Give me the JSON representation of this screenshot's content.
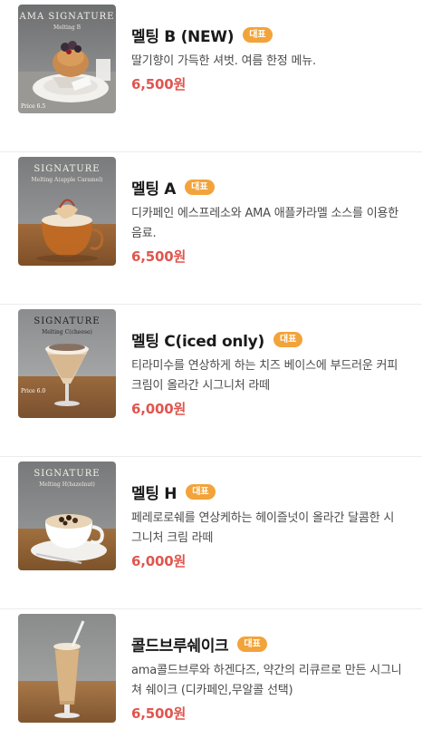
{
  "badge_color": "#f2a33a",
  "price_color": "#e0564f",
  "items": [
    {
      "name": "멜팅 B (NEW)",
      "badge": "대표",
      "description": "딸기향이 가득한 셔벗. 여름 한정 메뉴.",
      "price": "6,500원",
      "photo": {
        "sign_title": "AMA SIGNATURE",
        "sign_subtitle": "Melting B",
        "price_mark": "Price 6.5"
      }
    },
    {
      "name": "멜팅 A",
      "badge": "대표",
      "description": "디카페인 에스프레소와 AMA 애플카라멜 소스를 이용한 음료.",
      "price": "6,500원",
      "photo": {
        "sign_title": "SIGNATURE",
        "sign_subtitle": "Melting A(apple Caramel)",
        "price_mark": ""
      }
    },
    {
      "name": "멜팅 C(iced only)",
      "badge": "대표",
      "description": "티라미수를 연상하게 하는 치즈 베이스에 부드러운 커피크림이 올라간 시그니처 라떼",
      "price": "6,000원",
      "photo": {
        "sign_title": "SIGNATURE",
        "sign_subtitle": "Melting C(cheese)",
        "price_mark": "Price 6.0"
      }
    },
    {
      "name": "멜팅 H",
      "badge": "대표",
      "description": "페레로로쉐를 연상케하는 헤이즐넛이 올라간 달콤한 시그니처 크림 라떼",
      "price": "6,000원",
      "photo": {
        "sign_title": "SIGNATURE",
        "sign_subtitle": "Melting H(hazelnut)",
        "price_mark": ""
      }
    },
    {
      "name": "콜드브루쉐이크",
      "badge": "대표",
      "description": "ama콜드브루와 하겐다즈, 약간의 리큐르로 만든 시그니쳐 쉐이크 (디카페인,무알콜 선택)",
      "price": "6,500원",
      "photo": {
        "sign_title": "",
        "sign_subtitle": "",
        "price_mark": ""
      }
    }
  ]
}
